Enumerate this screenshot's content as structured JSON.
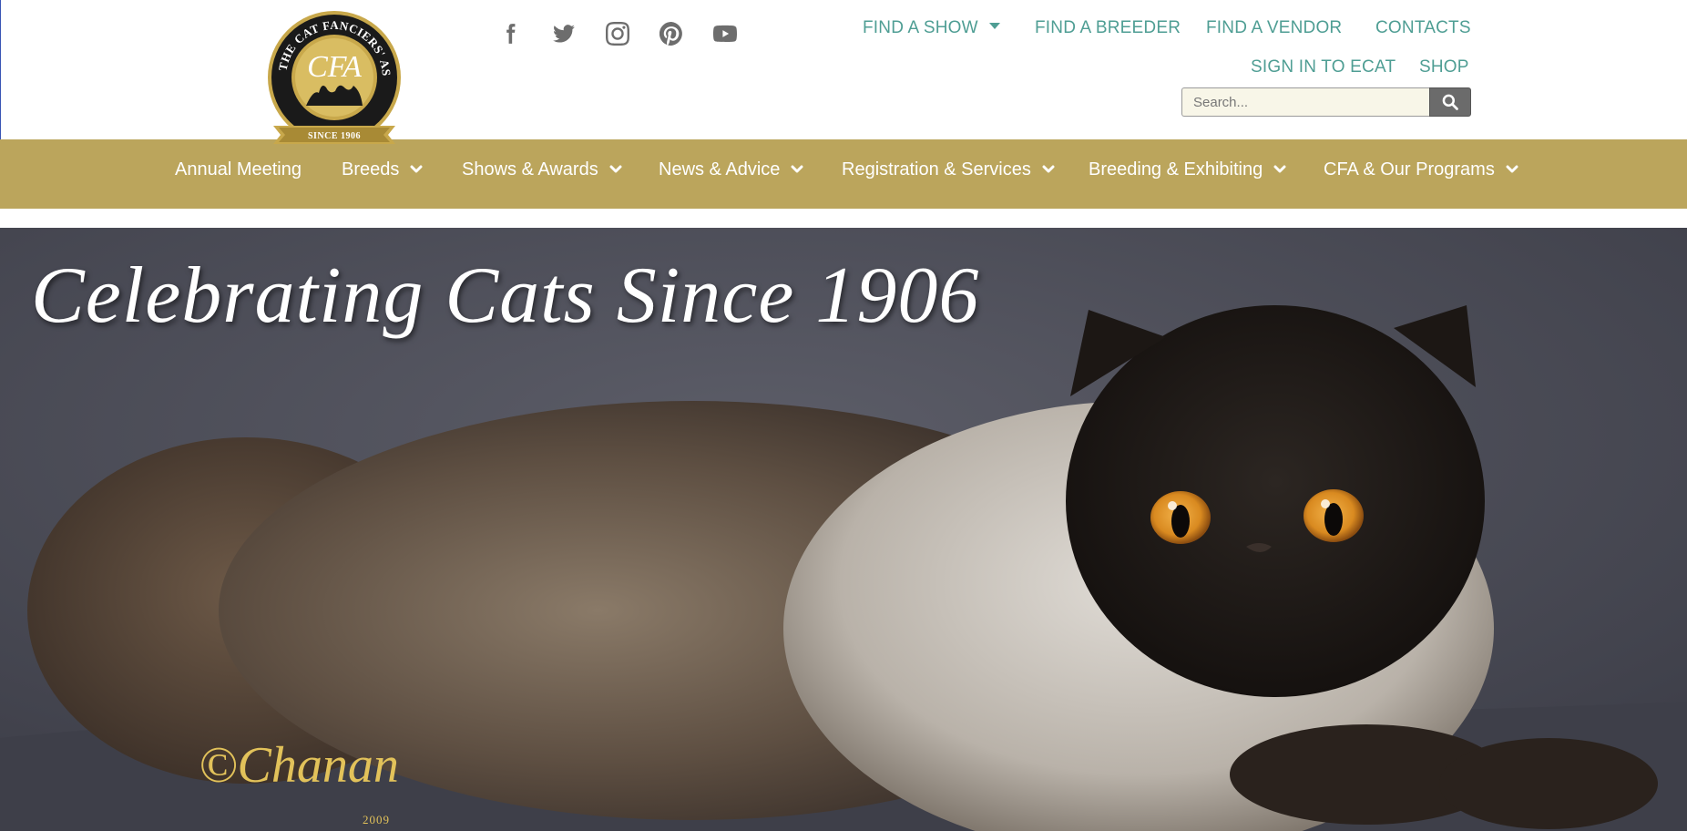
{
  "brand": {
    "logo_alt": "The Cat Fanciers' Association",
    "logo_ring_text": "THE CAT FANCIERS' ASSOCIATION",
    "logo_monogram": "CFA",
    "logo_since": "SINCE 1906"
  },
  "social": [
    {
      "name": "facebook-icon"
    },
    {
      "name": "twitter-icon"
    },
    {
      "name": "instagram-icon"
    },
    {
      "name": "pinterest-icon"
    },
    {
      "name": "youtube-icon"
    }
  ],
  "toplinks": {
    "find_show": "FIND A SHOW",
    "find_breeder": "FIND A BREEDER",
    "find_vendor": "FIND A VENDOR",
    "contacts": "CONTACTS",
    "sign_in": "SIGN IN TO ECAT",
    "shop": "SHOP"
  },
  "search": {
    "placeholder": "Search..."
  },
  "nav": {
    "items": [
      {
        "label": "Annual Meeting"
      },
      {
        "label": "Breeds"
      },
      {
        "label": "Shows & Awards"
      },
      {
        "label": "News & Advice"
      },
      {
        "label": "Registration & Services"
      },
      {
        "label": "Breeding & Exhibiting"
      },
      {
        "label": "CFA & Our Programs"
      }
    ]
  },
  "hero": {
    "title": "Celebrating Cats Since 1906",
    "signature": "©Chanan",
    "signature_year": "2009"
  },
  "colors": {
    "nav_gold": "#bba55c",
    "link_teal": "#4f9e94",
    "logo_gold": "#c8a84b"
  }
}
